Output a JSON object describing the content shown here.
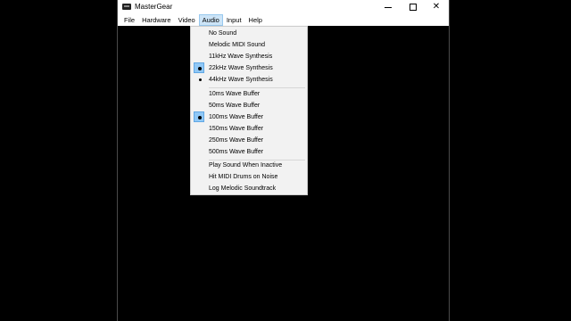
{
  "window": {
    "title": "MasterGear"
  },
  "menubar": {
    "items": [
      "File",
      "Hardware",
      "Video",
      "Audio",
      "Input",
      "Help"
    ]
  },
  "audio_menu": {
    "sound_items": [
      {
        "label": "No Sound",
        "state": "none"
      },
      {
        "label": "Melodic MIDI Sound",
        "state": "none"
      },
      {
        "label": "11kHz Wave Synthesis",
        "state": "none"
      },
      {
        "label": "22kHz Wave Synthesis",
        "state": "selected"
      },
      {
        "label": "44kHz Wave Synthesis",
        "state": "bullet"
      }
    ],
    "buffer_items": [
      {
        "label": "10ms Wave Buffer",
        "state": "none"
      },
      {
        "label": "50ms Wave Buffer",
        "state": "none"
      },
      {
        "label": "100ms Wave Buffer",
        "state": "selected"
      },
      {
        "label": "150ms Wave Buffer",
        "state": "none"
      },
      {
        "label": "250ms Wave Buffer",
        "state": "none"
      },
      {
        "label": "500ms Wave Buffer",
        "state": "none"
      }
    ],
    "option_items": [
      {
        "label": "Play Sound When Inactive"
      },
      {
        "label": "Hit MIDI Drums on Noise"
      },
      {
        "label": "Log Melodic Soundtrack"
      }
    ]
  },
  "icons": {
    "app": "app-icon",
    "minimize": "minimize-icon",
    "maximize": "maximize-icon",
    "close": "close-icon"
  },
  "colors": {
    "menu_highlight": "#cce4f7",
    "check_box": "#90c8f6",
    "background": "#000000"
  }
}
